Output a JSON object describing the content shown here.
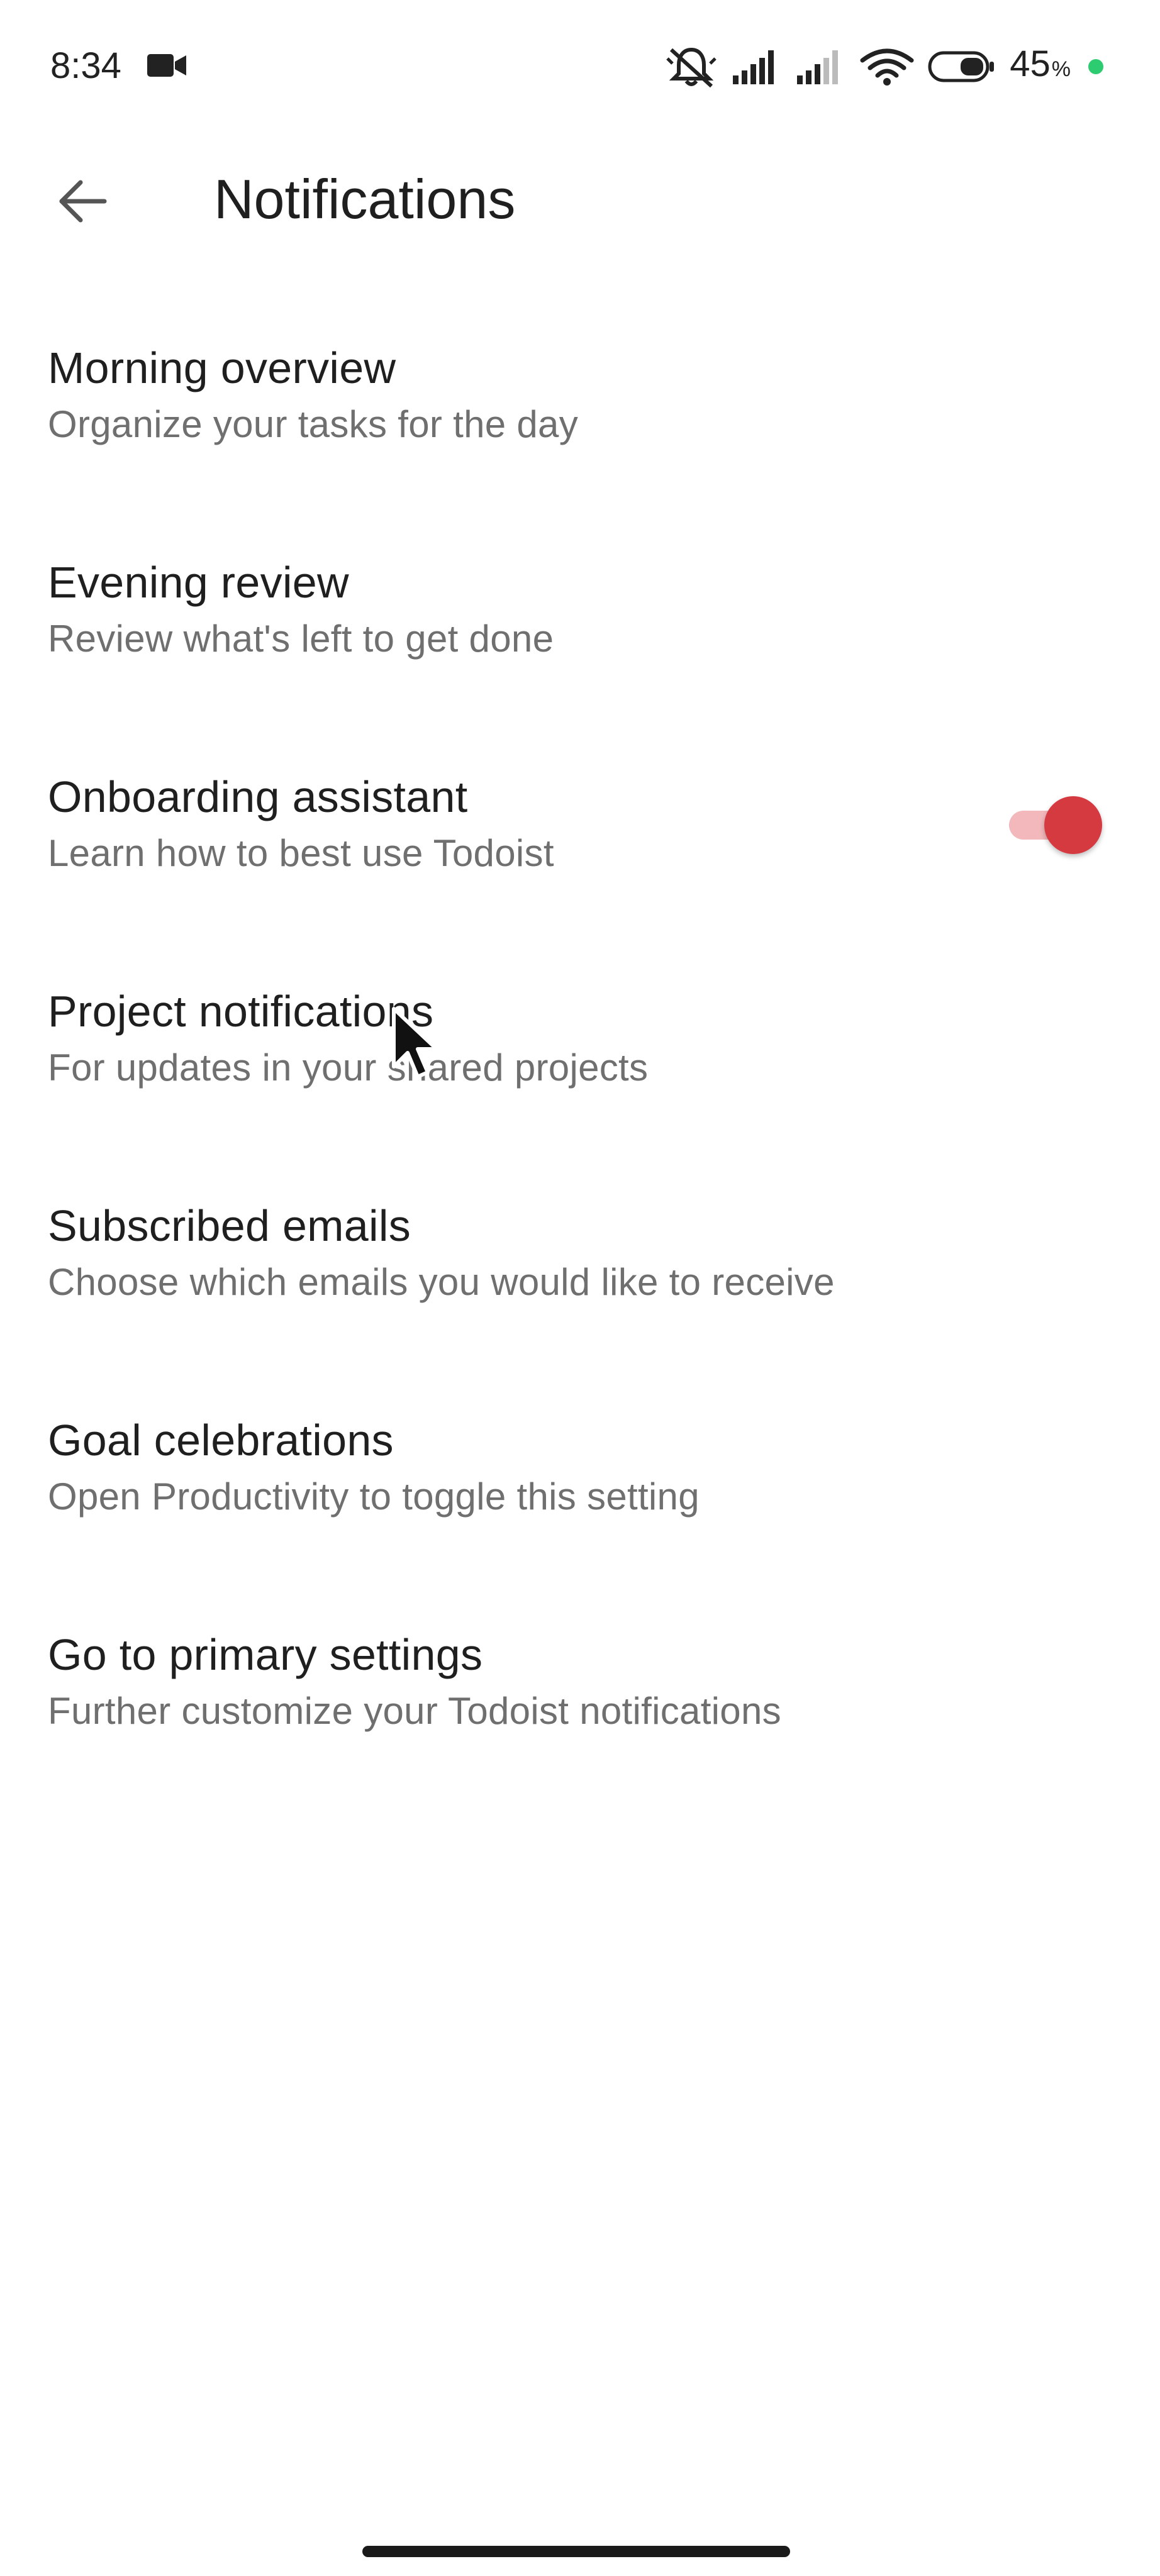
{
  "status_bar": {
    "time": "8:34",
    "battery_percent": "45",
    "battery_unit": "%",
    "icons": [
      "video-record-icon",
      "bell-muted-icon",
      "signal-icon",
      "signal-icon",
      "wifi-icon",
      "battery-icon",
      "status-dot-icon"
    ],
    "dot_color": "#2ecc71"
  },
  "app_bar": {
    "title": "Notifications",
    "back_icon": "arrow-left-icon"
  },
  "settings": [
    {
      "title": "Morning overview",
      "subtitle": "Organize your tasks for the day",
      "has_toggle": false
    },
    {
      "title": "Evening review",
      "subtitle": "Review what's left to get done",
      "has_toggle": false
    },
    {
      "title": "Onboarding assistant",
      "subtitle": "Learn how to best use Todoist",
      "has_toggle": true,
      "toggle_on": true
    },
    {
      "title": "Project notifications",
      "subtitle": "For updates in your shared projects",
      "has_toggle": false
    },
    {
      "title": "Subscribed emails",
      "subtitle": "Choose which emails you would like to receive",
      "has_toggle": false
    },
    {
      "title": "Goal celebrations",
      "subtitle": "Open Productivity to toggle this setting",
      "has_toggle": false
    },
    {
      "title": "Go to primary settings",
      "subtitle": "Further customize your Todoist notifications",
      "has_toggle": false
    }
  ],
  "colors": {
    "accent": "#d63a41",
    "accent_track": "#f2b8bc",
    "subtitle_text": "#6f6f6f",
    "title_text": "#1f1f1f"
  }
}
